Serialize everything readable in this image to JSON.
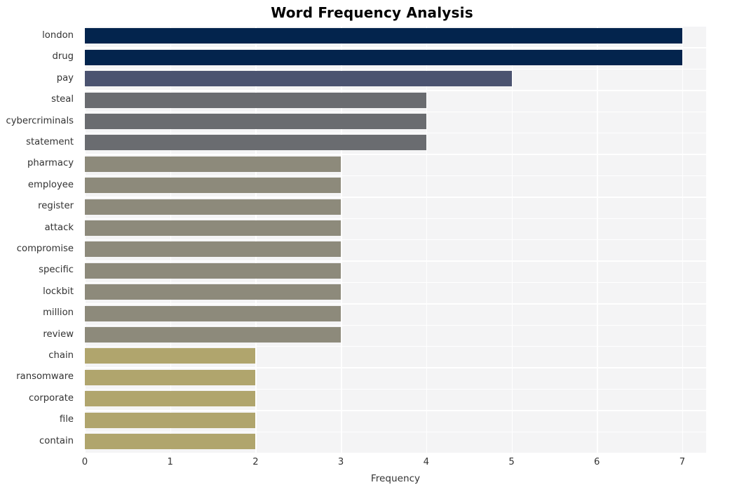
{
  "chart_data": {
    "type": "bar",
    "orientation": "horizontal",
    "title": "Word Frequency Analysis",
    "xlabel": "Frequency",
    "ylabel": "",
    "xlim": [
      0,
      7.28
    ],
    "xticks": [
      0,
      1,
      2,
      3,
      4,
      5,
      6,
      7
    ],
    "xtick_labels": [
      "0",
      "1",
      "2",
      "3",
      "4",
      "5",
      "6",
      "7"
    ],
    "grid": true,
    "legend": false,
    "categories": [
      "london",
      "drug",
      "pay",
      "steal",
      "cybercriminals",
      "statement",
      "pharmacy",
      "employee",
      "register",
      "attack",
      "compromise",
      "specific",
      "lockbit",
      "million",
      "review",
      "chain",
      "ransomware",
      "corporate",
      "file",
      "contain"
    ],
    "values": [
      7,
      7,
      5,
      4,
      4,
      4,
      3,
      3,
      3,
      3,
      3,
      3,
      3,
      3,
      3,
      2,
      2,
      2,
      2,
      2
    ],
    "bar_colors": [
      "#03244d",
      "#03244d",
      "#4b5370",
      "#6a6c70",
      "#6a6c70",
      "#6a6c70",
      "#8d8a7b",
      "#8d8a7b",
      "#8d8a7b",
      "#8d8a7b",
      "#8d8a7b",
      "#8d8a7b",
      "#8d8a7b",
      "#8d8a7b",
      "#8d8a7b",
      "#b0a56d",
      "#b0a56d",
      "#b0a56d",
      "#b0a56d",
      "#b0a56d"
    ],
    "plot_background": "#f4f4f5",
    "grid_color": "#ffffff",
    "figure_background": "#ffffff",
    "tick_label_color": "#333333",
    "title_color": "#000000"
  }
}
